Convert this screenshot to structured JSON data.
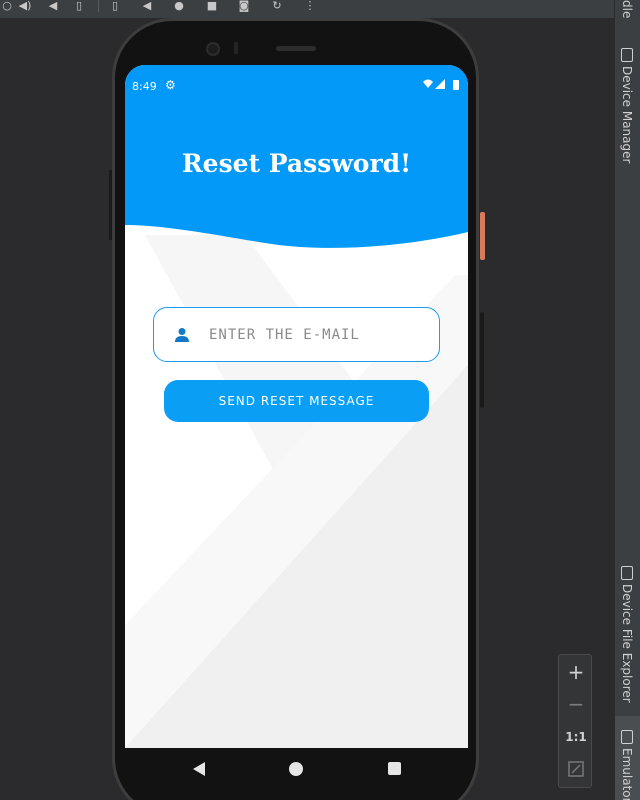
{
  "emulator": {
    "toolbar_icons": [
      "power-icon",
      "volume-up-icon",
      "volume-down-icon",
      "rotate-left-icon",
      "rotate-right-icon",
      "back-icon",
      "home-icon",
      "overview-icon",
      "screenshot-icon",
      "snapshot-icon",
      "more-icon"
    ],
    "right_panel": {
      "top_label": "dle",
      "device_manager": "Device Manager",
      "device_file_explorer": "Device File Explorer",
      "emulator": "Emulator"
    },
    "zoom": {
      "zoom_in": "+",
      "zoom_out": "−",
      "actual_size": "1:1"
    }
  },
  "app": {
    "status": {
      "time": "8:49"
    },
    "title": "Reset Password!",
    "email": {
      "placeholder": "ENTER THE E-MAIL",
      "value": ""
    },
    "send_button": "SEND RESET MESSAGE",
    "colors": {
      "primary": "#0a9ff5",
      "header": "#0399f8",
      "field_border": "#1e9bf0"
    }
  }
}
